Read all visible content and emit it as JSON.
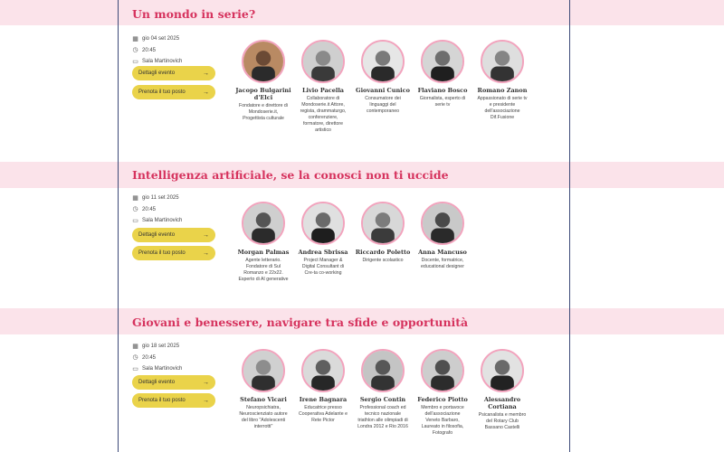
{
  "events": [
    {
      "title": "Un mondo in serie?",
      "date": "gio 04 set 2025",
      "time": "20:45",
      "place": "Sala Martinovich",
      "btn_details": "Dettagli evento",
      "btn_book": "Prenota il tuo posto",
      "speakers": [
        {
          "name": "Jacopo Bulgarini d'Elci",
          "role": "Fondatore e direttore di Mondoserie.it, Progettista culturale"
        },
        {
          "name": "Livio Pacella",
          "role": "Collaboratore di Mondoserie.it Attore, regista, drammaturgo, conferenziere, formatore, direttore artistico"
        },
        {
          "name": "Giovanni Cunico",
          "role": "Consumatore dei linguaggi del contemporaneo"
        },
        {
          "name": "Flaviano Bosco",
          "role": "Giornalista, esperto di serie tv"
        },
        {
          "name": "Romano Zanon",
          "role": "Appassionato di serie tv e presidente dell'associazione Dif.Fusione"
        }
      ]
    },
    {
      "title": "Intelligenza artificiale, se la conosci non ti uccide",
      "date": "gio 11 set 2025",
      "time": "20:45",
      "place": "Sala Martinovich",
      "btn_details": "Dettagli evento",
      "btn_book": "Prenota il tuo posto",
      "speakers": [
        {
          "name": "Morgan Palmas",
          "role": "Agente letterario. Fondatore di Sul Romanzo e 22x22. Esperto di AI generative"
        },
        {
          "name": "Andrea Sbrissa",
          "role": "Project Manager & Digital Consultant di Cre-ta co-working"
        },
        {
          "name": "Riccardo Poletto",
          "role": "Dirigente scolastico"
        },
        {
          "name": "Anna Mancuso",
          "role": "Docente, formatrice, educational designer"
        }
      ]
    },
    {
      "title": "Giovani e benessere, navigare tra sfide e opportunità",
      "date": "gio 18 set 2025",
      "time": "20:45",
      "place": "Sala Martinovich",
      "btn_details": "Dettagli evento",
      "btn_book": "Prenota il tuo posto",
      "speakers": [
        {
          "name": "Stefano Vicari",
          "role": "Neuropsichiatra, Neuroscienziato autore del libro \"Adolescenti interrotti\""
        },
        {
          "name": "Irene Bagnara",
          "role": "Educatrice presso Cooperativa Adelante e Rete Pictor"
        },
        {
          "name": "Sergio Contin",
          "role": "Professional coach ed tecnico nazionale triathlon alle olimpiadi di Londra 2012 e Rio 2016"
        },
        {
          "name": "Federico Piotto",
          "role": "Membro e portavoce dell'associazione Veneto Barbaro, Laureato in filosofia, Fotografo"
        },
        {
          "name": "Alessandro Cortiana",
          "role": "Psicanalista e membro del Rotary Club Bassano Castelli"
        }
      ]
    }
  ],
  "icons": {
    "date": "calendar-icon",
    "time": "clock-icon",
    "place": "map-icon",
    "arrow": "arrow-right-icon"
  },
  "colors": {
    "title": "#d6335e",
    "band": "#fbe3ea",
    "button": "#ead34a",
    "avatar_ring": "#f2a3bd"
  }
}
